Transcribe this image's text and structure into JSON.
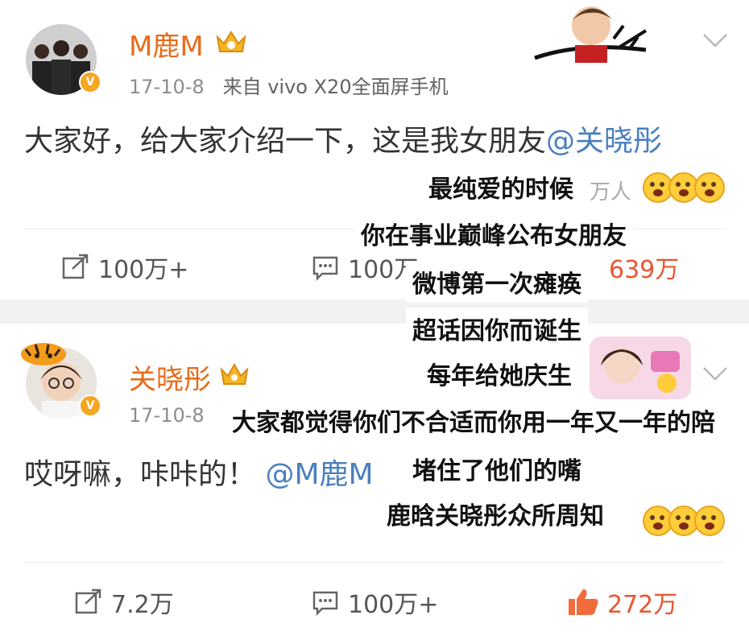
{
  "posts": [
    {
      "user": "M鹿M",
      "time": "17-10-8",
      "source": "来自 vivo X20全面屏手机",
      "text": "大家好，给大家介绍一下，这是我女朋友",
      "mention": "@关晓彤",
      "reposts": "100万+",
      "comments": "100万+",
      "likes": "639万"
    },
    {
      "user": "关晓彤",
      "time": "17-10-8",
      "text": "哎呀嘛，咔咔的！",
      "mention": "@M鹿M",
      "reposts": "7.2万",
      "comments": "100万+",
      "likes": "272万"
    }
  ],
  "overlay_captions": [
    "最纯爱的时候",
    "你在事业巅峰公布女朋友",
    "微博第一次瘫痪",
    "超话因你而诞生",
    "每年给她庆生",
    "大家都觉得你们不合适而你用一年又一年的陪",
    "堵住了他们的嘴",
    "鹿晗关晓彤众所周知"
  ],
  "partial_text": {
    "wan_people": "万人",
    "comment_partial": "100万"
  },
  "colors": {
    "username": "#e86b19",
    "mention": "#4a7fbf",
    "likes": "#e8552f",
    "verified_badge": "#f6a623"
  },
  "icons": [
    "repost-icon",
    "comment-icon",
    "thumbs-up-icon",
    "chevron-down-icon",
    "crown-icon",
    "verified-icon",
    "emoji-icon"
  ]
}
